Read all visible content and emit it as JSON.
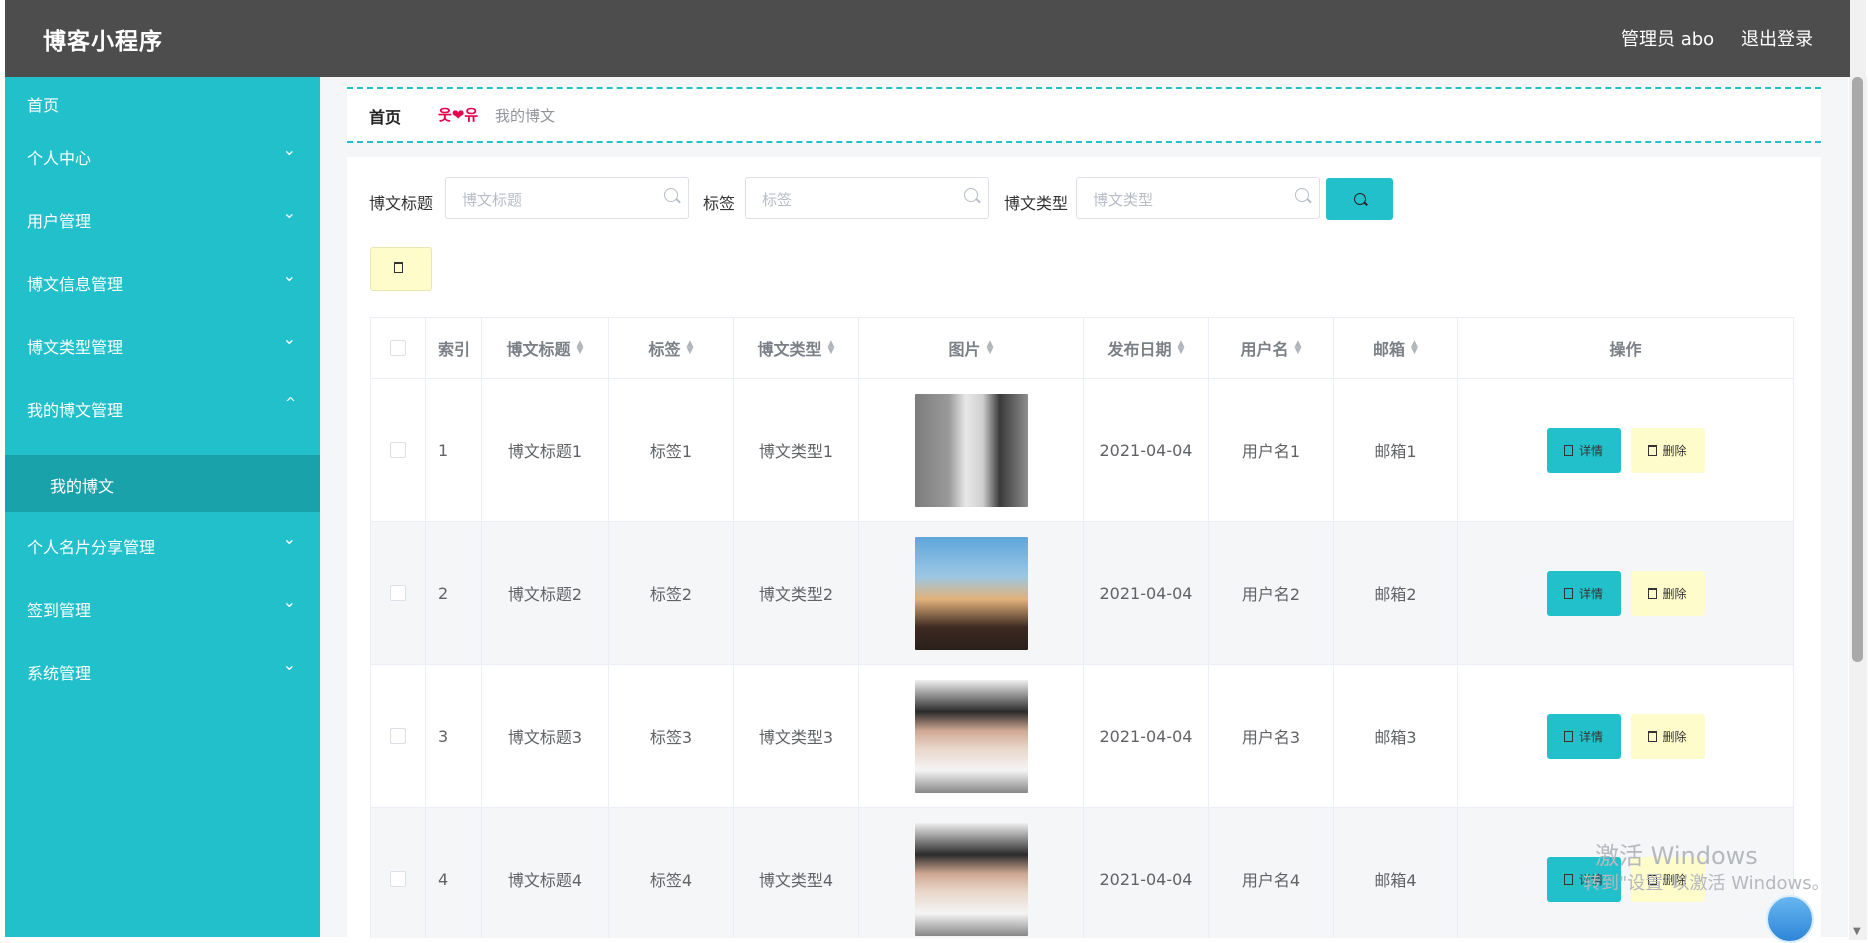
{
  "header": {
    "brand": "博客小程序",
    "admin": "管理员 abo",
    "logout": "退出登录"
  },
  "sidebar": {
    "items": [
      {
        "label": "首页",
        "chevron": ""
      },
      {
        "label": "个人中心",
        "chevron": "⌄"
      },
      {
        "label": "用户管理",
        "chevron": "⌄"
      },
      {
        "label": "博文信息管理",
        "chevron": "⌄"
      },
      {
        "label": "博文类型管理",
        "chevron": "⌄"
      },
      {
        "label": "我的博文管理",
        "chevron": "^"
      },
      {
        "label": "个人名片分享管理",
        "chevron": "⌄"
      },
      {
        "label": "签到管理",
        "chevron": "⌄"
      },
      {
        "label": "系统管理",
        "chevron": "⌄"
      }
    ],
    "active_sub": "我的博文"
  },
  "breadcrumb": {
    "home": "首页",
    "separator": "웃❤유",
    "current": "我的博文"
  },
  "search": {
    "title_label": "博文标题",
    "title_placeholder": "博文标题",
    "tag_label": "标签",
    "tag_placeholder": "标签",
    "type_label": "博文类型",
    "type_placeholder": "博文类型"
  },
  "table": {
    "headers": [
      "索引",
      "博文标题",
      "标签",
      "博文类型",
      "图片",
      "发布日期",
      "用户名",
      "邮箱",
      "操作"
    ],
    "rows": [
      {
        "index": "1",
        "title": "博文标题1",
        "tag": "标签1",
        "type": "博文类型1",
        "date": "2021-04-04",
        "user": "用户名1",
        "email": "邮箱1"
      },
      {
        "index": "2",
        "title": "博文标题2",
        "tag": "标签2",
        "type": "博文类型2",
        "date": "2021-04-04",
        "user": "用户名2",
        "email": "邮箱2"
      },
      {
        "index": "3",
        "title": "博文标题3",
        "tag": "标签3",
        "type": "博文类型3",
        "date": "2021-04-04",
        "user": "用户名3",
        "email": "邮箱3"
      },
      {
        "index": "4",
        "title": "博文标题4",
        "tag": "标签4",
        "type": "博文类型4",
        "date": "2021-04-04",
        "user": "用户名4",
        "email": "邮箱4"
      }
    ],
    "detail_label": "详情",
    "delete_label": "删除"
  },
  "watermark": {
    "line1": "激活 Windows",
    "line2": "转到\"设置\"以激活 Windows。"
  },
  "colors": {
    "accent": "#22c0cb",
    "header": "#4d4d4d",
    "delete_bg": "#fffccc"
  }
}
